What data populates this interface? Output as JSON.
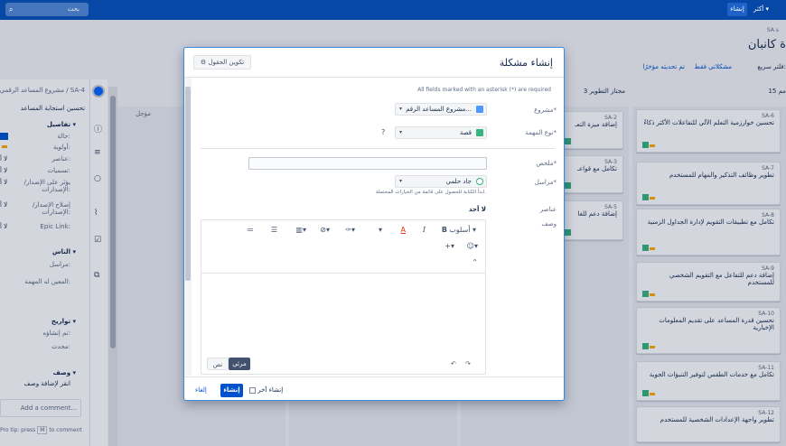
{
  "topbar": {
    "search_placeholder": "بحث",
    "create_label": "إنشاء",
    "more_label": "أكثر"
  },
  "page": {
    "breadcrumb": "SA ة",
    "title": "ة كانبان",
    "filters": {
      "quick_label": "فلتر سريع:",
      "only_my_issues": "مشكلاتي فقط",
      "recently_updated": "تم تحديثه مؤخرًا"
    },
    "columns": [
      {
        "label": "15 مم"
      },
      {
        "label": "3 مجتاز التطوير"
      }
    ]
  },
  "cards_right": [
    {
      "key": "SA-6",
      "text": "تحسين خوارزمية التعلم الآلي للتفاعلات الأكثر ذكاءً"
    },
    {
      "key": "SA-7",
      "text": "تطوير وظائف التذكير والمهام للمستخدم"
    },
    {
      "key": "SA-8",
      "text": "تكامل مع تطبيقات التقويم لإدارة الجداول الزمنية"
    },
    {
      "key": "SA-9",
      "text": "إضافة دعم للتفاعل مع التقويم الشخصي للمستخدم"
    },
    {
      "key": "SA-10",
      "text": "تحسين قدرة المساعد على تقديم المعلومات الإخبارية"
    },
    {
      "key": "SA-11",
      "text": "تكامل مع خدمات الطقس لتوفير التنبؤات الجوية"
    },
    {
      "key": "SA-12",
      "text": "تطوير واجهة الإعدادات الشخصية للمستخدم"
    }
  ],
  "cards_mid": [
    {
      "key": "SA-2",
      "text": "إضافة ميزة التعـ"
    },
    {
      "key": "SA-3",
      "text": "تكامل مع قواعـ"
    },
    {
      "key": "SA-5",
      "text": "إضافة دعم للغا"
    }
  ],
  "left_panel": {
    "project": "مشروع المساعد الرقمي / SA-4",
    "summary": "تحسين استجابة المساعد",
    "details_header": "تفاصيل",
    "status_label": "حالة:",
    "priority_label": "أولوية:",
    "components_label": "عناصر:",
    "labels_label": "تسميات:",
    "affects_label": "يؤثر على الإصدار/ الإصدارات:",
    "fix_label": "إصلاح الإصدار/ الإصدارات:",
    "epic_label": "Epic Link:",
    "none_value": "لا أ",
    "people_header": "الناس",
    "reporter_label": "مراسل:",
    "assignee_label": "المعين له المهمة:",
    "dates_header": "تواريخ",
    "created_label": "تم إنشاؤه:",
    "updated_label": "محدث:",
    "desc_header": "وصف",
    "desc_hint": "انقر لإضافة وصف",
    "comment_placeholder": "Add a comment...",
    "pro_tip": "Pro tip: press",
    "pro_tip_key": "M",
    "pro_tip_end": "to comment"
  },
  "modal": {
    "title": "إنشاء مشكلة",
    "configure_fields": "تكوين الحقول",
    "required_note": "All fields marked with an asterisk (*) are required",
    "project_label": "مشروع*",
    "project_value": "مشروع المساعد الرقم...",
    "issue_type_label": "نوع المهمة*",
    "issue_type_value": "قصة",
    "summary_label": "ملخص*",
    "reporter_label": "مراسل*",
    "reporter_value": "جاد حلمي",
    "reporter_hint": "ابدأ الكتابة للحصول على قائمة من الخيارات المحتملة.",
    "components_label": "عناصر",
    "components_value": "لا أحد",
    "description_label": "وصف",
    "toolbar_style": "أسلوب",
    "tab_visual": "مرئي",
    "tab_text": "نص",
    "create_another": "إنشاء آخر",
    "create_button": "إنشاء",
    "cancel_button": "إلغاء"
  },
  "colors": {
    "topbar": "#0747a6",
    "primary": "#0052cc",
    "story": "#36b37e",
    "priority": "#ffab00"
  }
}
